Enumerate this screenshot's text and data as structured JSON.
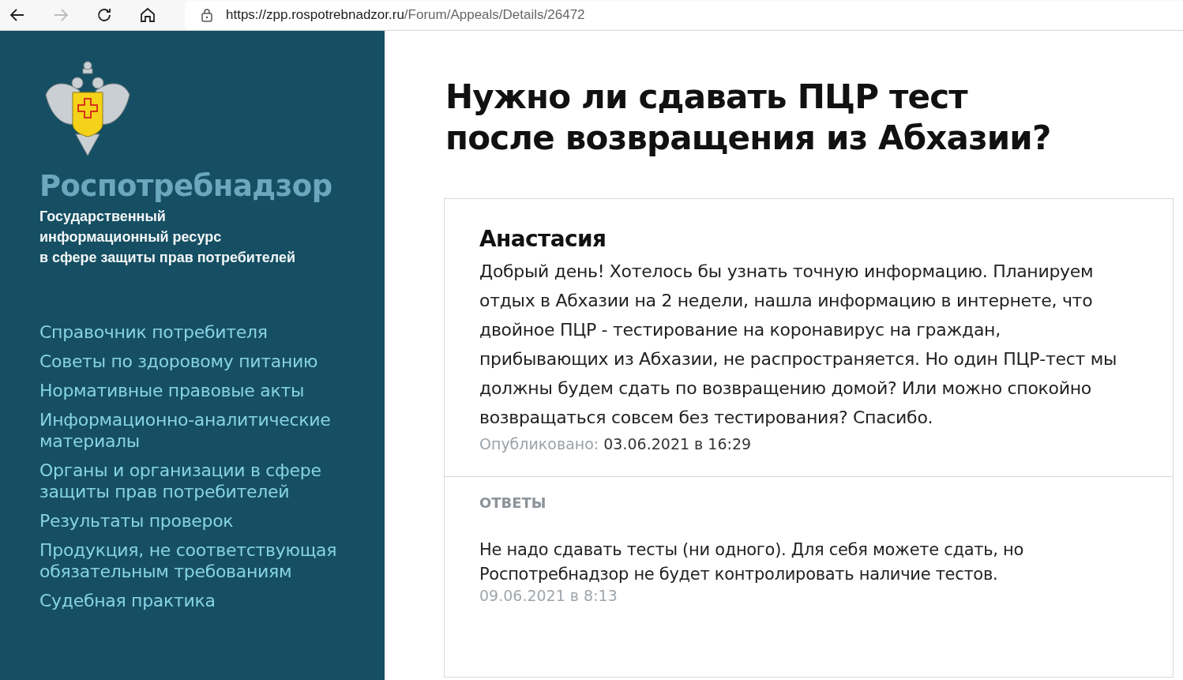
{
  "browser": {
    "url_host": "https://zpp.rospotrebnadzor.ru",
    "url_path": "/Forum/Appeals/Details/26472",
    "forward_disabled": true
  },
  "sidebar": {
    "brand": "Роспотребнадзор",
    "tagline": [
      "Государственный",
      "информационный ресурс",
      "в сфере защиты прав потребителей"
    ],
    "nav": [
      {
        "label": "Справочник потребителя"
      },
      {
        "label": "Советы по здоровому питанию"
      },
      {
        "label": "Нормативные правовые акты"
      },
      {
        "label": "Информационно-аналитические материалы"
      },
      {
        "label": "Органы и организации в сфере защиты прав потребителей"
      },
      {
        "label": "Результаты проверок"
      },
      {
        "label": "Продукция, не соответствующая обязательным требованиям"
      },
      {
        "label": "Судебная практика"
      }
    ]
  },
  "question": {
    "title": "Нужно ли сдавать ПЦР тест после возвращения из Абхазии?",
    "author": "Анастасия",
    "text": "Добрый день! Хотелось бы узнать точную информацию. Планируем отдых в Абхазии на 2 недели, нашла информацию в интернете, что двойное ПЦР - тестирование на коронавирус на граждан, прибывающих из Абхазии, не распространяется. Но один ПЦР-тест мы должны будем сдать по возвращению домой? Или можно спокойно возвращаться совсем без тестирования? Спасибо.",
    "published_label": "Опубликовано:",
    "published_date": "03.06.2021 в 16:29"
  },
  "answers": {
    "heading": "ОТВЕТЫ",
    "items": [
      {
        "text": "Не надо сдавать тесты (ни одного). Для себя можете сдать, но Роспотребнадзор не будет контролировать наличие тестов.",
        "date": "09.06.2021 в 8:13"
      }
    ]
  }
}
